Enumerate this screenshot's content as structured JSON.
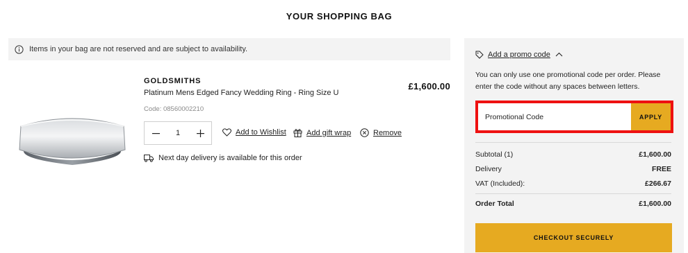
{
  "header": {
    "title": "YOUR SHOPPING BAG"
  },
  "notice": {
    "text": "Items in your bag are not reserved and are subject to availability."
  },
  "item": {
    "brand": "GOLDSMITHS",
    "name": "Platinum Mens Edged Fancy Wedding Ring - Ring Size U",
    "code": "Code: 08560002210",
    "price": "£1,600.00",
    "quantity": "1",
    "actions": {
      "wishlist": "Add to Wishlist",
      "gift_wrap": "Add gift wrap",
      "remove": "Remove"
    },
    "delivery": "Next day delivery is available for this order"
  },
  "summary": {
    "promo_toggle": "Add a promo code",
    "promo_note": "You can only use one promotional code per order. Please enter the code without any spaces between letters.",
    "promo_placeholder": "Promotional Code",
    "apply": "APPLY",
    "rows": [
      {
        "label": "Subtotal (1)",
        "value": "£1,600.00"
      },
      {
        "label": "Delivery",
        "value": "FREE"
      },
      {
        "label": "VAT (Included):",
        "value": "£266.67"
      }
    ],
    "total": {
      "label": "Order Total",
      "value": "£1,600.00"
    },
    "checkout": "CHECKOUT SECURELY"
  },
  "colors": {
    "accent": "#e6aa21",
    "highlight": "#ee1111",
    "panel": "#f3f3f3"
  },
  "icons": [
    "info-icon",
    "ring-image",
    "minus-icon",
    "plus-icon",
    "heart-icon",
    "gift-icon",
    "close-circle-icon",
    "truck-icon",
    "tag-icon",
    "chevron-up-icon"
  ]
}
